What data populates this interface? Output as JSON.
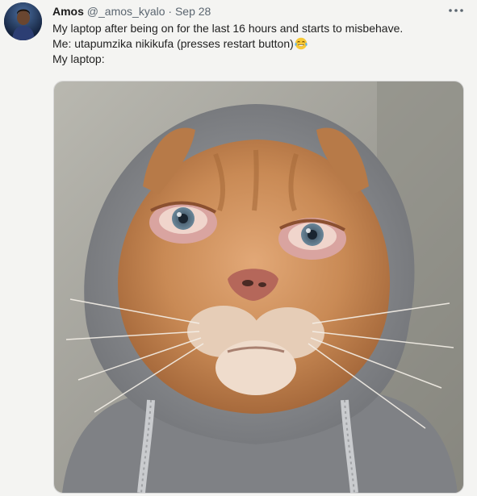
{
  "tweet": {
    "display_name": "Amos",
    "handle": "@_amos_kyalo",
    "separator": "·",
    "date": "Sep 28",
    "more_icon": "more-horizontal-icon",
    "lines": [
      "My laptop after being on for the last 16 hours and starts to misbehave.",
      "Me: utapumzika nikikufa (presses restart button)",
      "My laptop:"
    ],
    "emoji": "face-with-tears-of-joy-icon"
  },
  "colors": {
    "background": "#f4f4f2",
    "secondary_text": "#5b6670",
    "hoodie": "#8d8f93",
    "fur": "#c98a55"
  }
}
